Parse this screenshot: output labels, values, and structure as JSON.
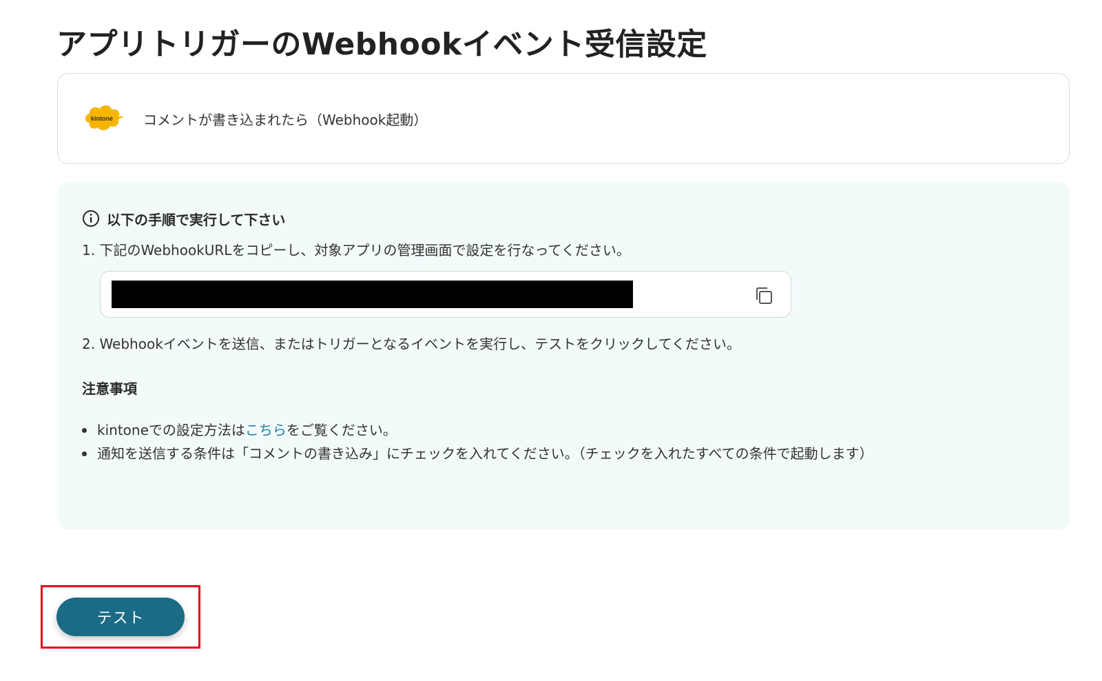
{
  "page": {
    "title": "アプリトリガーのWebhookイベント受信設定"
  },
  "trigger": {
    "logo_text": "kintone",
    "label": "コメントが書き込まれたら（Webhook起動）",
    "logo_color": "#f7b500"
  },
  "instructions": {
    "heading": "以下の手順で実行して下さい",
    "step1": "1. 下記のWebhookURLをコピーし、対象アプリの管理画面で設定を行なってください。",
    "step2": "2. Webhookイベントを送信、またはトリガーとなるイベントを実行し、テストをクリックしてください。",
    "notes_heading": "注意事項",
    "note1_prefix": "kintoneでの設定方法は",
    "note1_link": "こちら",
    "note1_suffix": "をご覧ください。",
    "note2": "通知を送信する条件は「コメントの書き込み」にチェックを入れてください。（チェックを入れたすべての条件で起動します）"
  },
  "actions": {
    "test_label": "テスト"
  },
  "colors": {
    "panel_bg": "#f2fafa",
    "button_bg": "#1a6b85",
    "highlight": "#e4001b",
    "link": "#1f7fa8"
  }
}
